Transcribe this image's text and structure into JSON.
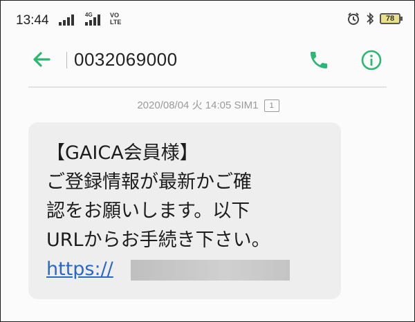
{
  "status_bar": {
    "time": "13:44",
    "network_badge": "4G",
    "volte_label": "VO\nLTE",
    "battery_level": "78",
    "icons": [
      "signal-icon",
      "signal-4g-icon",
      "volte-icon",
      "alarm-icon",
      "bluetooth-icon",
      "battery-icon"
    ]
  },
  "header": {
    "phone_number": "0032069000",
    "icons": [
      "back-arrow-icon",
      "phone-icon",
      "info-icon"
    ],
    "accent_color": "#2bb673"
  },
  "message_meta": {
    "date": "2020/08/04",
    "weekday": "火",
    "time": "14:05",
    "sim": "SIM1",
    "sim_badge": "1"
  },
  "message": {
    "lines": [
      "【GAICA会員様】",
      "ご登録情報が最新かご確",
      "認をお願いします。以下",
      "URLからお手続き下さい。"
    ],
    "link_text": "https://",
    "link_color": "#2a66c6",
    "bubble_color": "#eeeeee"
  }
}
